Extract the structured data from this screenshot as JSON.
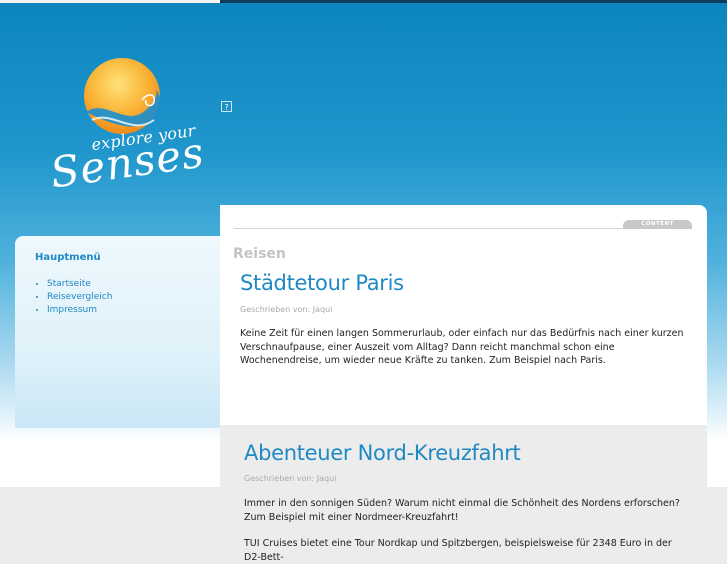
{
  "logo": {
    "tagline": "explore your",
    "wordmark": "Senses"
  },
  "broken_image": {
    "glyph": "?"
  },
  "sidebar": {
    "title": "Hauptmenü",
    "items": [
      {
        "label": "Startseite"
      },
      {
        "label": "Reisevergleich"
      },
      {
        "label": "Impressum"
      }
    ]
  },
  "content": {
    "tab_label": "CONTENT",
    "section_title": "Reisen"
  },
  "articles": [
    {
      "title": "Städtetour Paris",
      "meta": "Geschrieben von: Jaqui",
      "text": "Keine Zeit für einen langen Sommerurlaub, oder einfach nur das Bedürfnis nach einer kurzen Verschnaufpause, einer Auszeit vom Alltag? Dann reicht manchmal schon eine Wochenendreise, um wieder neue Kräfte zu tanken. Zum Beispiel nach Paris."
    },
    {
      "title": "Abenteuer Nord-Kreuzfahrt",
      "meta": "Geschrieben von: Jaqui",
      "text": "Immer in den sonnigen Süden? Warum nicht einmal die Schönheit des Nordens erforschen? Zum Beispiel mit einer Nordmeer-Kreuzfahrt!",
      "text2": "TUI Cruises bietet eine Tour Nordkap und Spitzbergen, beispielsweise für 2348 Euro in der D2-Bett-"
    }
  ],
  "colors": {
    "accent": "#1f89c4",
    "sky_top": "#0c84be",
    "sun": "#f5a623"
  }
}
